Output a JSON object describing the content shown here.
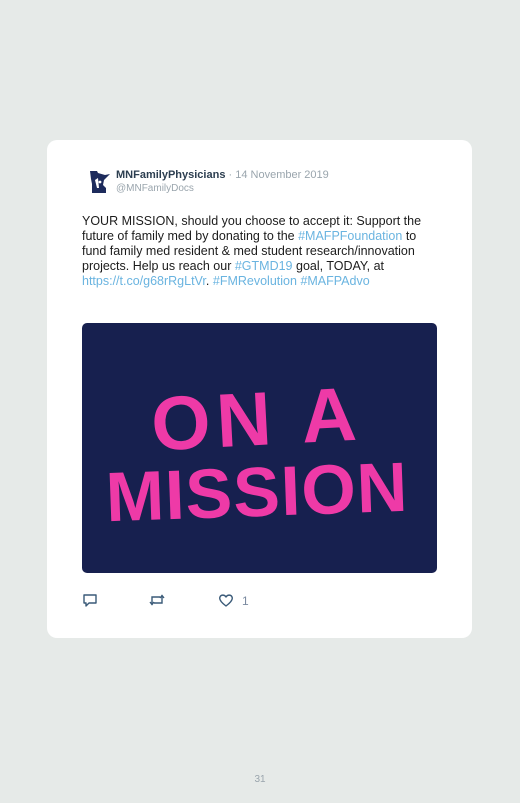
{
  "tweet": {
    "author_name": "MNFamilyPhysicians",
    "separator": " · ",
    "date": "14 November 2019",
    "handle": "@MNFamilyDocs",
    "text": {
      "t1": "YOUR MISSION, should you choose to accept it: Support the future of family med by donating to the ",
      "h1": "#MAFPFoundation",
      "t2": " to fund family med resident & med student research/innovation projects. Help us reach our ",
      "h2": "#GTMD19",
      "t3": " goal, TODAY, at ",
      "url": "https://t.co/g68rRgLtVr",
      "t4": ". ",
      "h3": "#FMRevolution",
      "t5": " ",
      "h4": "#MAFPAdvo"
    },
    "media": {
      "line1": "ON A",
      "line2": "MISSION",
      "bg_color": "#17204f",
      "text_color": "#ee3aa7"
    },
    "actions": {
      "reply_icon": "reply-icon",
      "retweet_icon": "retweet-icon",
      "like_icon": "heart-icon",
      "like_count": "1"
    }
  },
  "page_number": "31"
}
